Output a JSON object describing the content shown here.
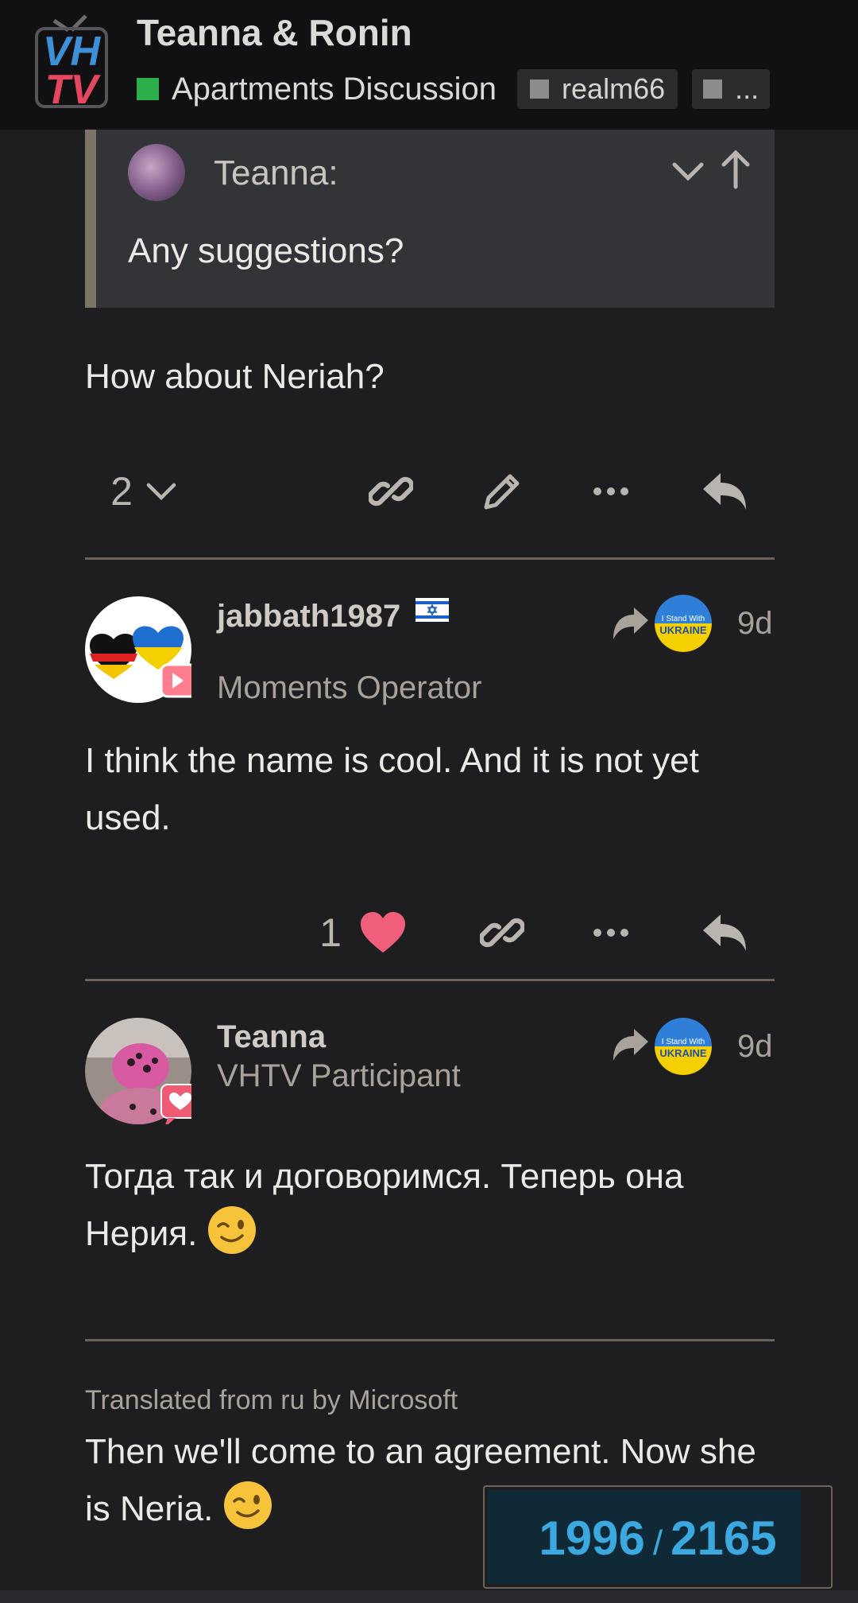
{
  "header": {
    "logo_line1": "VH",
    "logo_line2": "TV",
    "topic_title": "Teanna & Ronin",
    "category": "Apartments Discussion",
    "tags": [
      "realm66",
      "..."
    ],
    "colors": {
      "category": "#2eae4a",
      "logo_blue": "#3d8fd6",
      "logo_red": "#e5475f"
    }
  },
  "quote": {
    "author": "Teanna:",
    "text": "Any suggestions?"
  },
  "post1": {
    "text": "How about Neriah?",
    "replies_count": "2"
  },
  "post2": {
    "username": "jabbath1987",
    "flag": "israel-flag",
    "user_title": "Moments Operator",
    "badge_text": "I Stand With UKRAINE",
    "age": "9d",
    "text": "I think the name is cool. And it is not yet used.",
    "likes": "1"
  },
  "post3": {
    "username": "Teanna",
    "user_title": "VHTV Participant",
    "badge_text": "I Stand With UKRAINE",
    "age": "9d",
    "text": "Тогда так и договоримся. Теперь она Нерия.",
    "translated_label": "Translated from ru by Microsoft",
    "translation": "Then we'll come to an agreement. Now she is Neria."
  },
  "progress": {
    "current": "1996",
    "separator": "/",
    "total": "2165",
    "fraction": 0.922
  },
  "icons": [
    "chevron-down-icon",
    "arrow-up-icon",
    "link-icon",
    "pencil-icon",
    "more-icon",
    "reply-icon",
    "heart-icon",
    "share-icon",
    "winking-emoji"
  ]
}
